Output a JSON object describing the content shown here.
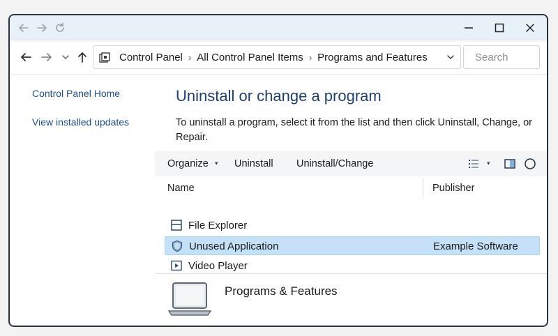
{
  "titlebar": {
    "icons": [
      "back-arrow-icon",
      "forward-arrow-icon",
      "refresh-icon"
    ],
    "controls": [
      "minimize-icon",
      "maximize-icon",
      "close-icon"
    ]
  },
  "address": {
    "crumbs": [
      "Control Panel",
      "All Control Panel Items",
      "Programs and Features"
    ],
    "separator": "›"
  },
  "search": {
    "placeholder": "Search",
    "value": ""
  },
  "left_pane": {
    "links": [
      "Control Panel Home",
      "View installed updates"
    ]
  },
  "main": {
    "title": "Uninstall or change a program",
    "description": "To uninstall a program, select it from the list and then click Uninstall, Change, or Repair."
  },
  "toolbar": {
    "organize": "Organize",
    "organize_caret": "▾",
    "uninstall": "Uninstall",
    "uninstall_change": "Uninstall/Change",
    "view_caret": "▾"
  },
  "list": {
    "columns": [
      "Name",
      "Publisher"
    ],
    "rows": [
      {
        "name": "File Explorer",
        "publisher": "",
        "icon": "window-icon",
        "selected": false
      },
      {
        "name": "Unused Application",
        "publisher": "Example Software",
        "icon": "shield-icon",
        "selected": true
      },
      {
        "name": "Video Player",
        "publisher": "",
        "icon": "play-icon",
        "selected": false
      }
    ]
  },
  "details": {
    "title": "Programs & Features",
    "icon": "laptop-icon"
  },
  "colors": {
    "link": "#1c4e8a",
    "title": "#1f3f6e",
    "selection": "#c5e1f7",
    "titlebar": "#e9f1f8"
  }
}
